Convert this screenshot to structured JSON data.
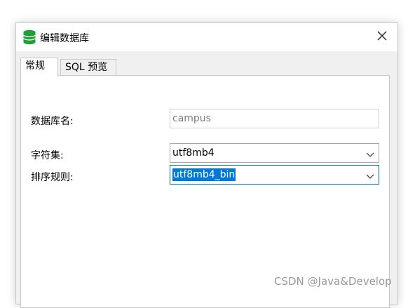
{
  "window": {
    "title": "编辑数据库",
    "icon": "database-icon",
    "close_icon": "close-icon"
  },
  "tabs": [
    {
      "label": "常规",
      "active": true
    },
    {
      "label": "SQL 预览",
      "active": false
    }
  ],
  "form": {
    "db_name": {
      "label": "数据库名:",
      "value": "campus"
    },
    "charset": {
      "label": "字符集:",
      "value": "utf8mb4"
    },
    "collation": {
      "label": "排序规则:",
      "value": "utf8mb4_bin"
    }
  },
  "watermark": "CSDN @Java&Develop",
  "colors": {
    "icon_green": "#1f9e3a",
    "selection": "#0078d7",
    "focus_border": "#0067c0"
  }
}
